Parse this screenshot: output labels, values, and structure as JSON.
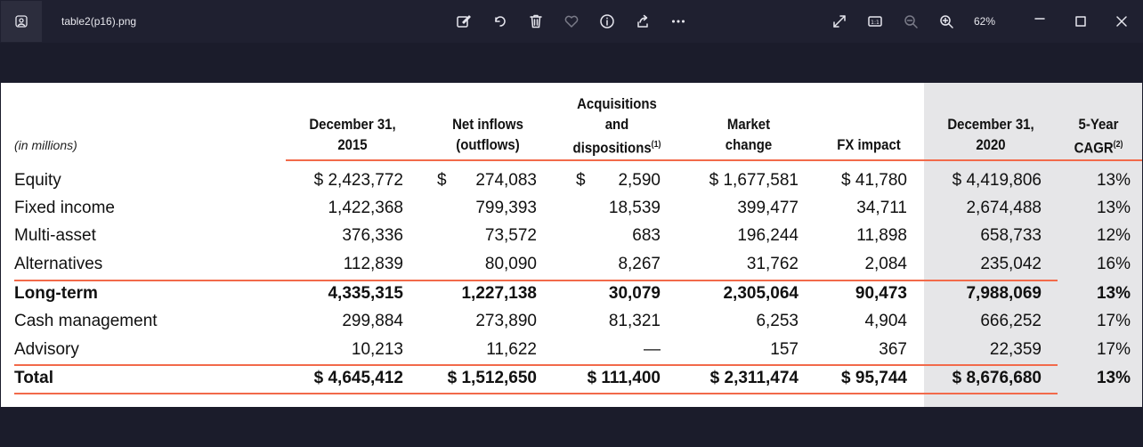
{
  "window": {
    "filename": "table2(p16).png",
    "zoom": "62%",
    "actual_size_label": "1:1"
  },
  "icons": {
    "app": "photo-icon",
    "edit": "edit-image-icon",
    "rotate": "rotate-icon",
    "delete": "trash-icon",
    "favorite": "heart-icon",
    "info": "info-icon",
    "share": "share-icon",
    "more": "more-icon",
    "fullscreen": "expand-icon",
    "actual_size": "actual-size-icon",
    "zoom_out": "zoom-out-icon",
    "zoom_in": "zoom-in-icon"
  },
  "colors": {
    "accent_rule": "#f26a4a",
    "shade": "#e6e6e8"
  },
  "table": {
    "unit_label": "(in millions)",
    "headers": [
      {
        "line1": "December 31,",
        "line2": "2015",
        "sup": ""
      },
      {
        "line1": "Net inflows",
        "line2": "(outflows)",
        "sup": ""
      },
      {
        "line0": "Acquisitions",
        "line1": "and",
        "line2": "dispositions",
        "sup": "(1)"
      },
      {
        "line1": "Market",
        "line2": "change",
        "sup": ""
      },
      {
        "line1": "",
        "line2": "FX impact",
        "sup": ""
      },
      {
        "line1": "December 31,",
        "line2": "2020",
        "sup": ""
      },
      {
        "line1": "5-Year",
        "line2": "CAGR",
        "sup": "(2)"
      }
    ],
    "rows": [
      {
        "label": "Equity",
        "cells": [
          "$ 2,423,772",
          "$",
          "274,083",
          "$",
          "2,590",
          "$ 1,677,581",
          "$ 41,780",
          "$ 4,419,806",
          "13%"
        ]
      },
      {
        "label": "Fixed income",
        "cells": [
          "1,422,368",
          "",
          "799,393",
          "",
          "18,539",
          "399,477",
          "34,711",
          "2,674,488",
          "13%"
        ]
      },
      {
        "label": "Multi-asset",
        "cells": [
          "376,336",
          "",
          "73,572",
          "",
          "683",
          "196,244",
          "11,898",
          "658,733",
          "12%"
        ]
      },
      {
        "label": "Alternatives",
        "cells": [
          "112,839",
          "",
          "80,090",
          "",
          "8,267",
          "31,762",
          "2,084",
          "235,042",
          "16%"
        ]
      },
      {
        "label": "Long-term",
        "cells": [
          "4,335,315",
          "",
          "1,227,138",
          "",
          "30,079",
          "2,305,064",
          "90,473",
          "7,988,069",
          "13%"
        ]
      },
      {
        "label": "Cash management",
        "cells": [
          "299,884",
          "",
          "273,890",
          "",
          "81,321",
          "6,253",
          "4,904",
          "666,252",
          "17%"
        ]
      },
      {
        "label": "Advisory",
        "cells": [
          "10,213",
          "",
          "11,622",
          "",
          "—",
          "157",
          "367",
          "22,359",
          "17%"
        ]
      },
      {
        "label": "Total",
        "cells": [
          "$ 4,645,412",
          "",
          "$ 1,512,650",
          "",
          "$ 111,400",
          "$ 2,311,474",
          "$ 95,744",
          "$ 8,676,680",
          "13%"
        ]
      }
    ]
  }
}
